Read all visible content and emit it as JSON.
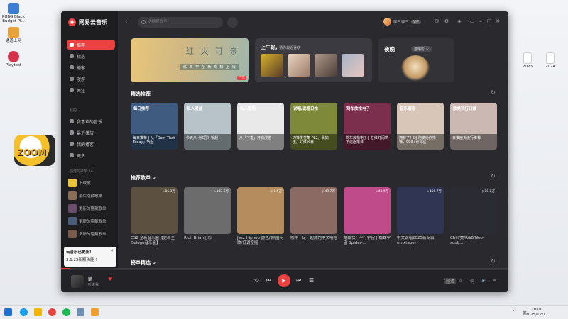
{
  "desktop": {
    "icons": [
      {
        "label": "PUBG Black Budget Pl..."
      },
      {
        "label": "通道上网"
      },
      {
        "label": "Playtest"
      },
      {
        "label": "2023"
      },
      {
        "label": "2024"
      }
    ],
    "zoom_logo": "ZOOM"
  },
  "app": {
    "brand": "网易云音乐",
    "search_placeholder": "劝睡眠歌手",
    "user_name": "李三李三",
    "vip": "VIP",
    "nav": [
      {
        "label": "推荐"
      },
      {
        "label": "精选"
      },
      {
        "label": "播客"
      },
      {
        "label": "漫游"
      },
      {
        "label": "关注"
      }
    ],
    "my_section": "我的",
    "my_items": [
      {
        "label": "我喜欢的音乐"
      },
      {
        "label": "最近播放"
      },
      {
        "label": "我的播客"
      },
      {
        "label": "更多"
      }
    ],
    "created_section": "创建的歌单 14",
    "playlists": [
      {
        "label": "下载歌"
      },
      {
        "label": "最后隐藏歌单"
      },
      {
        "label": "更新的隐藏歌单"
      },
      {
        "label": "更新的隐藏歌单"
      },
      {
        "label": "多新的隐藏歌单"
      }
    ]
  },
  "banners": {
    "ad_title": "红 火 可 亲",
    "ad_sub": "陈 再 学 全 新 专 辑 上 线",
    "ad_badge": "广告",
    "greeting": "上午好,",
    "greeting_sub": "猜你最近喜欢",
    "night_title": "夜晚",
    "night_select": "选电影 ~"
  },
  "sections": {
    "featured": "精选推荐",
    "recommended": "推荐歌单 >",
    "charts": "榜单精选 >"
  },
  "featured_cards": [
    {
      "tag": "每日推荐",
      "caption": "每日推荐 | 从「Doin That Today」听起",
      "color": "#3f5b80"
    },
    {
      "tag": "私人漫游",
      "caption": "今天从《红豆》听起",
      "color": "#b7c3c9"
    },
    {
      "tag": "私人雷达",
      "caption": "从「下垂」开启漫游",
      "color": "#e9e9e9"
    },
    {
      "tag": "说唱/说唱日推",
      "caption": "刀锋发觉角 PL2。我如玉。好红风暴",
      "color": "#7e8a3a"
    },
    {
      "tag": "驾车放松电子",
      "caption": "驾车放松电子 | 在红灯闹哄下追逐落日",
      "color": "#7b2f4c"
    },
    {
      "tag": "音乐播客",
      "caption": "拥有了！DJ 阿婆给你推荐，999+评论区",
      "color": "#d8c6b8"
    },
    {
      "tag": "欧美流行日推",
      "caption": "日推欧美流行推荐",
      "color": "#cbb8b2"
    }
  ],
  "playlist_cards": [
    {
      "count": "85.3万",
      "caption": "CS2 全新音乐盒【更新至Deluge音乐盒】",
      "color": "#5c5040"
    },
    {
      "count": "383.6万",
      "caption": "Rich Brian七彩",
      "color": "#6c6c6c"
    },
    {
      "count": "1.6万",
      "caption": "Jazz Hiphop 爵色/爵嘻|闲歌/低调慢摇",
      "color": "#b58c5e"
    },
    {
      "count": "49.7万",
      "caption": "咖啡十足：超燃的中文嘻哈",
      "color": "#8b6a63"
    },
    {
      "count": "43.9万",
      "caption": "酷眩快：平行宇宙 | 蜘蛛宇宙 Spider-...",
      "color": "#c04b8a"
    },
    {
      "count": "456.7万",
      "caption": "中文说唱2025新专辑(mixtape)",
      "color": "#2f3552"
    },
    {
      "count": "18.8万",
      "caption": "Chill/美/R&B/Neo-soul/...",
      "color": "#2b2b33"
    }
  ],
  "toast": {
    "title": "云音乐已更新!",
    "body": "3.1.25新版功能 !"
  },
  "player": {
    "title": "躺",
    "artist": "听说我",
    "progress": 0.02,
    "quality": "超清"
  },
  "taskbar": {
    "lang": "英",
    "time": "10:00",
    "date": "2025/12/17"
  }
}
